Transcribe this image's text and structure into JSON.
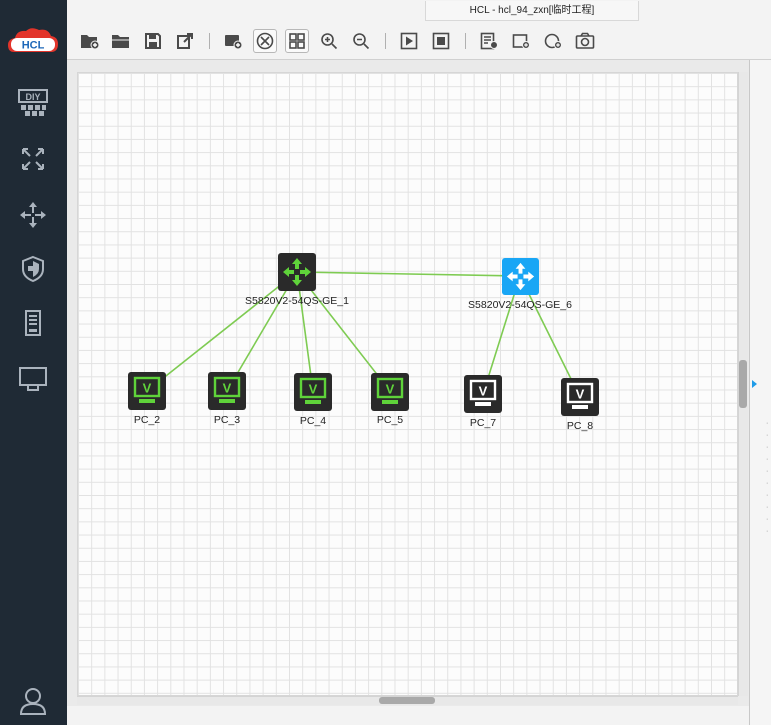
{
  "app": {
    "logo_text": "HCL",
    "window_title": "HCL - hcl_94_zxn[临时工程]"
  },
  "sidebar": {
    "items": [
      {
        "name": "diy-icon",
        "label": "DIY"
      },
      {
        "name": "router-icon"
      },
      {
        "name": "switch-icon"
      },
      {
        "name": "firewall-icon"
      },
      {
        "name": "server-icon"
      },
      {
        "name": "terminal-icon"
      }
    ],
    "user_icon": "user-icon"
  },
  "toolbar": {
    "buttons": [
      "new-project-icon",
      "open-project-icon",
      "save-icon",
      "export-icon",
      "import-device-icon",
      "topology-icon",
      "grid-icon",
      "zoom-in-icon",
      "zoom-out-icon",
      "start-icon",
      "stop-icon",
      "list-icon",
      "add-rectangle-icon",
      "add-ellipse-icon",
      "screenshot-icon"
    ]
  },
  "topology": {
    "switches": [
      {
        "id": "sw1",
        "label": "S5820V2-54QS-GE_1",
        "color": "#2a2a2a",
        "accent": "#5fd33a"
      },
      {
        "id": "sw6",
        "label": "S5820V2-54QS-GE_6",
        "color": "#19a6f5",
        "accent": "#ffffff"
      }
    ],
    "pcs": [
      {
        "id": "pc2",
        "label": "PC_2",
        "state": "running",
        "accent": "#5fd33a"
      },
      {
        "id": "pc3",
        "label": "PC_3",
        "state": "running",
        "accent": "#5fd33a"
      },
      {
        "id": "pc4",
        "label": "PC_4",
        "state": "running",
        "accent": "#5fd33a"
      },
      {
        "id": "pc5",
        "label": "PC_5",
        "state": "running",
        "accent": "#5fd33a"
      },
      {
        "id": "pc7",
        "label": "PC_7",
        "state": "stopped",
        "accent": "#ffffff"
      },
      {
        "id": "pc8",
        "label": "PC_8",
        "state": "stopped",
        "accent": "#ffffff"
      }
    ],
    "link_color": "#7ecb52",
    "pc_glyph": "V"
  }
}
